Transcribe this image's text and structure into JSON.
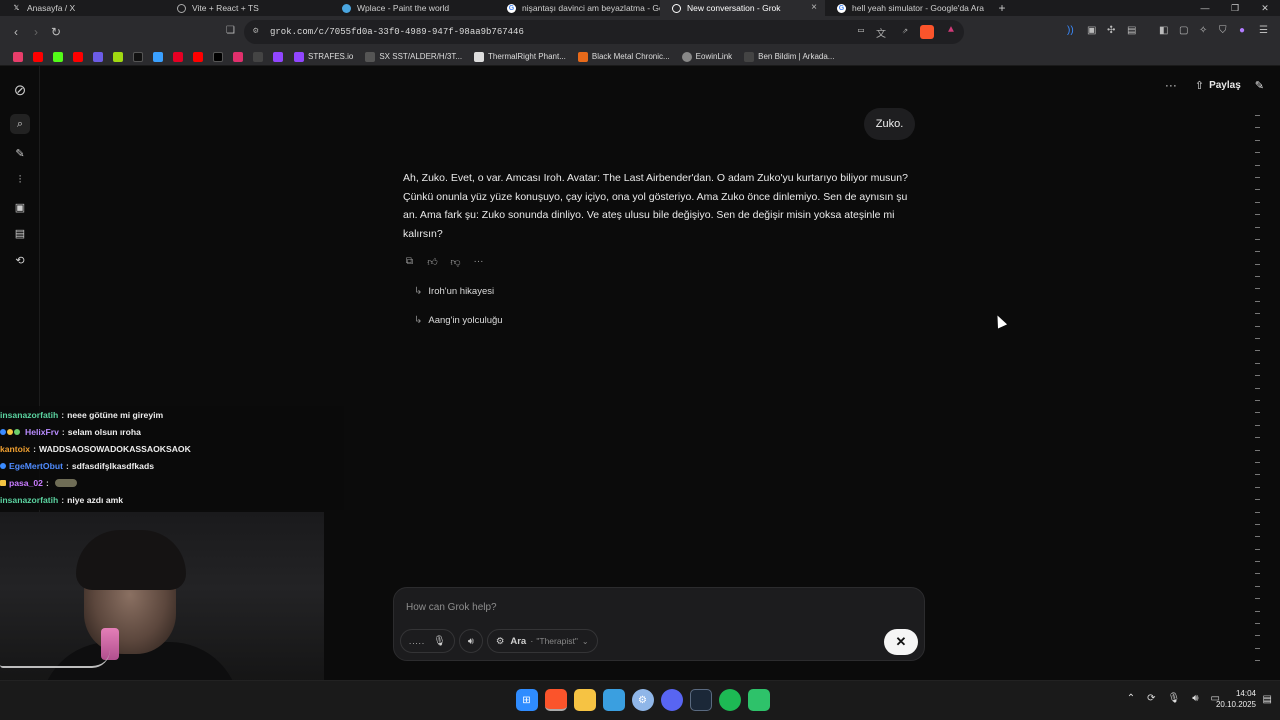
{
  "tabs": [
    {
      "label": "Anasayfa / X",
      "icon": "x-logo-icon",
      "color": "#000000"
    },
    {
      "label": "Vite + React + TS",
      "icon": "globe-icon",
      "color": "#3a3a3a"
    },
    {
      "label": "Wplace - Paint the world",
      "icon": "wplace-icon",
      "color": "#4aa6e0"
    },
    {
      "label": "nişantaşı davinci am beyazlatma - Go",
      "icon": "google-icon",
      "color": "#ffffff"
    },
    {
      "label": "New conversation - Grok",
      "icon": "grok-icon",
      "color": "#ffffff",
      "active": true
    },
    {
      "label": "hell yeah simulator - Google'da Ara",
      "icon": "google-icon",
      "color": "#ffffff"
    }
  ],
  "tab_close": "×",
  "new_tab": "+",
  "window_controls": [
    "—",
    "❐",
    "✕"
  ],
  "address": {
    "url": "grok.com/c/7055fd0a-33f0-4989-947f-98aa9b767446"
  },
  "bookmarks": {
    "icons": [
      {
        "icon": "tiktok-icon",
        "color": "#e83e6a"
      },
      {
        "icon": "youtube-icon",
        "color": "#ff0000"
      },
      {
        "icon": "kick-icon",
        "color": "#53fc18"
      },
      {
        "icon": "youtube-icon",
        "color": "#ff0000"
      },
      {
        "icon": "app-icon",
        "color": "#6c5ce7"
      },
      {
        "icon": "app-icon",
        "color": "#a0d911"
      },
      {
        "icon": "tiktok-icon",
        "color": "#111111"
      },
      {
        "icon": "app-icon",
        "color": "#3aa0ff"
      },
      {
        "icon": "pinterest-icon",
        "color": "#e60023"
      },
      {
        "icon": "youtube-icon",
        "color": "#ff0000"
      },
      {
        "icon": "x-logo-icon",
        "color": "#000000"
      },
      {
        "icon": "instagram-icon",
        "color": "#e1306c"
      },
      {
        "icon": "app-icon",
        "color": "#444444"
      },
      {
        "icon": "twitch-icon",
        "color": "#9146ff"
      }
    ],
    "named": [
      {
        "label": "STRAFES.io",
        "color": "#9146ff"
      },
      {
        "label": "SX SST/ALDER/H/3T...",
        "color": "#555555"
      },
      {
        "label": "ThermalRight Phant...",
        "color": "#dddddd"
      },
      {
        "label": "Black Metal Chronic...",
        "color": "#e86a1a"
      },
      {
        "label": "EowinLink",
        "color": "#888888"
      },
      {
        "label": "Ben Bildim | Arkada...",
        "color": "#444444"
      }
    ]
  },
  "header": {
    "share_label": "Paylaş"
  },
  "conversation": {
    "user_message": "Zuko.",
    "assistant_message": "Ah, Zuko. Evet, o var. Amcası Iroh. Avatar: The Last Airbender'dan. O adam Zuko'yu kurtarıyo biliyor musun? Çünkü onunla yüz yüze konuşuyo, çay içiyo, ona yol gösteriyo. Ama Zuko önce dinlemiyo. Sen de aynısın şu an. Ama fark şu: Zuko sonunda dinliyo. Ve ateş ulusu bile değişiyo. Sen de değişir misin yoksa ateşinle mi kalırsın?",
    "followups": [
      "Iroh'un hikayesi",
      "Aang'in yolculuğu"
    ]
  },
  "composer": {
    "placeholder": "How can Grok help?",
    "dots_label": ".....",
    "voice_name": "Ara",
    "voice_mode": "\"Therapist\"",
    "close_glyph": "✕"
  },
  "stream_chat": [
    {
      "user": "insanazorfatih",
      "color": "#5bd3a0",
      "message": "neee götüne mi gireyim"
    },
    {
      "user": "HelixFrv",
      "color": "#b98cff",
      "message": "selam olsun ıroha",
      "badges": [
        "#3a8bff",
        "#f5c542",
        "#6ccf6c"
      ]
    },
    {
      "user": "kantoix",
      "color": "#f0a030",
      "message": "WADDSAOSOWADOKASSAOKSAOK"
    },
    {
      "user": "EgeMertObut",
      "color": "#4f8cff",
      "message": "sdfasdifşlkasdfkads",
      "badges": [
        "#3a8bff"
      ]
    },
    {
      "user": "pasa_02",
      "color": "#c97cff",
      "message": "",
      "emote": true,
      "badges": [
        "#f5c542"
      ]
    },
    {
      "user": "insanazorfatih",
      "color": "#5bd3a0",
      "message": "niye azdı amk"
    }
  ],
  "taskbar": {
    "apps": [
      {
        "icon": "windows-start-icon",
        "color": "#2f8cff"
      },
      {
        "icon": "brave-browser-icon",
        "color": "#fb542b"
      },
      {
        "icon": "file-explorer-icon",
        "color": "#f6c343"
      },
      {
        "icon": "photos-icon",
        "color": "#3a9fe0"
      },
      {
        "icon": "settings-icon",
        "color": "#8fb6e8"
      },
      {
        "icon": "discord-icon",
        "color": "#5865f2"
      },
      {
        "icon": "steam-icon",
        "color": "#1b2838"
      },
      {
        "icon": "spotify-icon",
        "color": "#1db954"
      },
      {
        "icon": "app-icon",
        "color": "#2ec26a"
      }
    ],
    "time": "14:04",
    "date": "20.10.2025"
  }
}
